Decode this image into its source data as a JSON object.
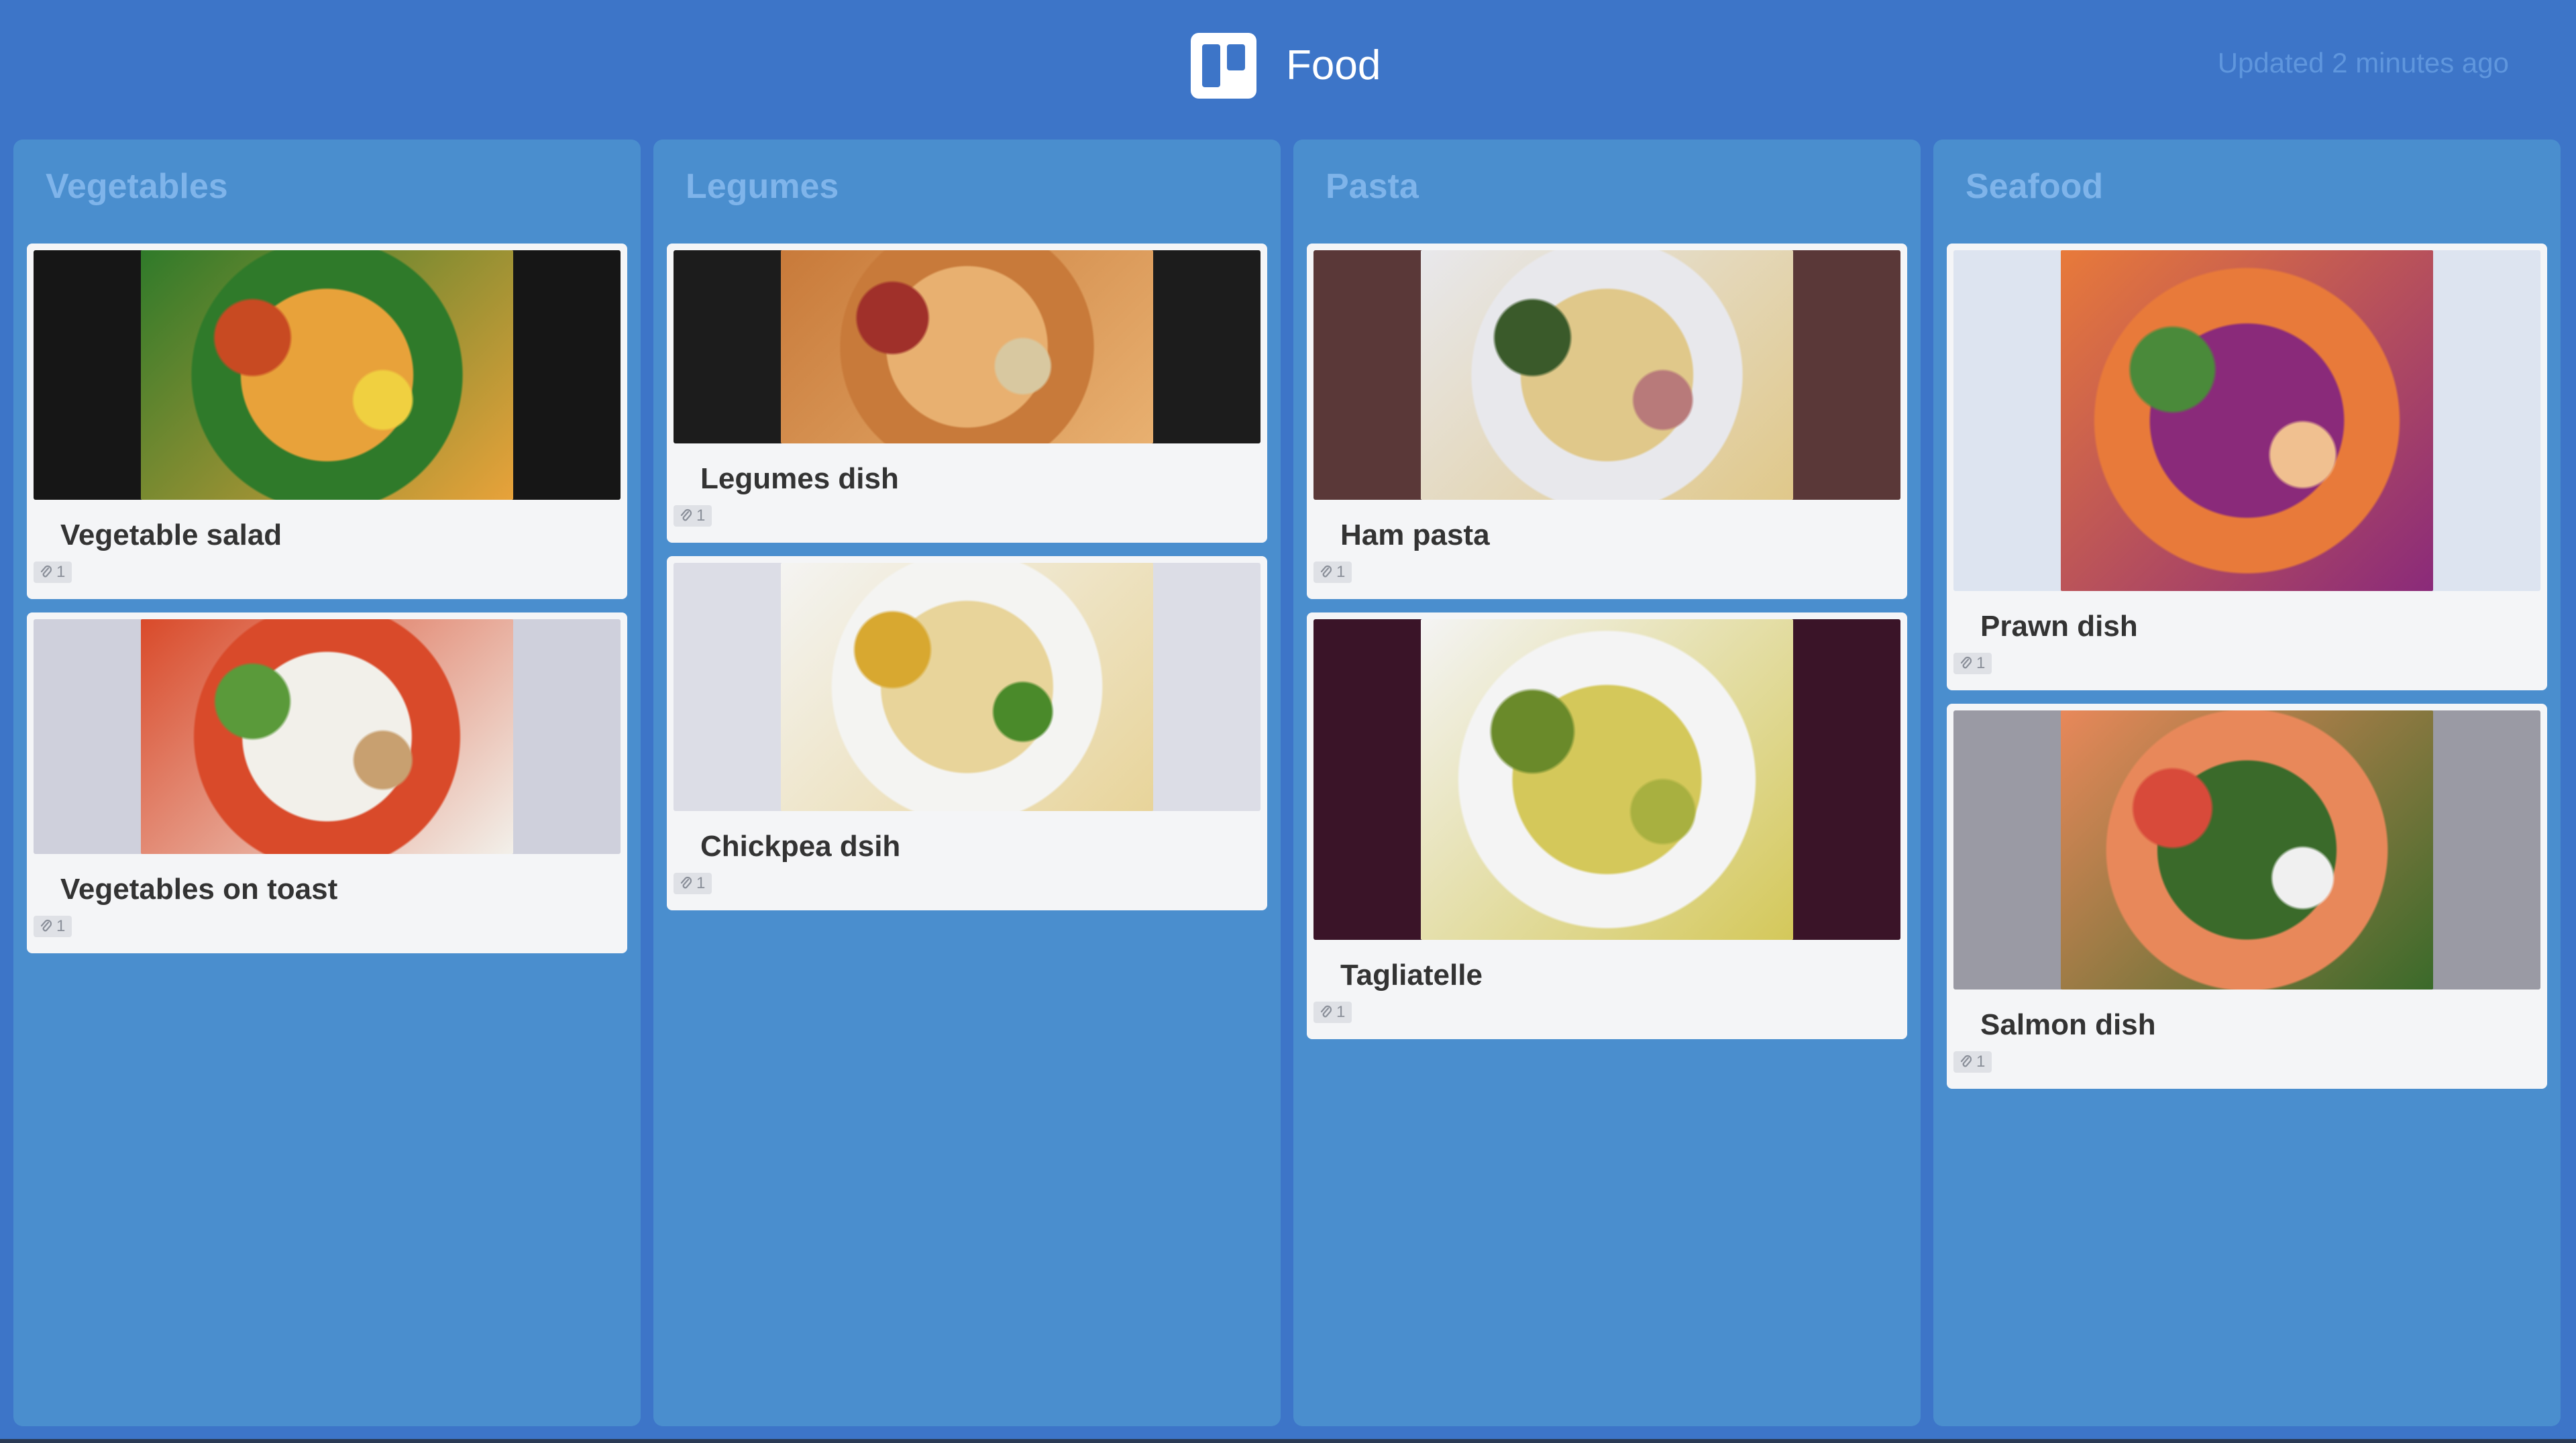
{
  "header": {
    "board_title": "Food",
    "updated_text": "Updated 2 minutes ago",
    "logo_icon": "trello-board-icon"
  },
  "colors": {
    "background": "#3d75c8",
    "column": "#4a8ece",
    "column_title": "#7fb4ea",
    "card": "#f4f5f7",
    "updated_text": "#5f96dd"
  },
  "columns": [
    {
      "title": "Vegetables",
      "cards": [
        {
          "title": "Vegetable salad",
          "attachments": "1",
          "cover_bg": "#161616",
          "photo_colors": [
            "#2f7a2a",
            "#e8a23a",
            "#c84a22",
            "#f0d040"
          ]
        },
        {
          "title": "Vegetables on toast",
          "attachments": "1",
          "cover_bg": "#cfd0dc",
          "photo_colors": [
            "#d94a2a",
            "#f2f0ea",
            "#5a9a3a",
            "#c8a070"
          ]
        }
      ]
    },
    {
      "title": "Legumes",
      "cards": [
        {
          "title": "Legumes dish",
          "attachments": "1",
          "cover_bg": "#1c1c1c",
          "photo_colors": [
            "#c87a3a",
            "#e8b070",
            "#a0302a",
            "#d8c8a0"
          ]
        },
        {
          "title": "Chickpea dsih",
          "attachments": "1",
          "cover_bg": "#dcdde6",
          "photo_colors": [
            "#f4f4f2",
            "#e8d49a",
            "#d8a830",
            "#4a8a2a"
          ]
        }
      ]
    },
    {
      "title": "Pasta",
      "cards": [
        {
          "title": "Ham pasta",
          "attachments": "1",
          "cover_bg": "#5a3838",
          "photo_colors": [
            "#e8e8ec",
            "#e0c88a",
            "#3a5a2a",
            "#b87a7a"
          ]
        },
        {
          "title": "Tagliatelle",
          "attachments": "1",
          "cover_bg": "#3a1428",
          "photo_colors": [
            "#f4f4f4",
            "#d4c85a",
            "#6a8a2a",
            "#a8b040"
          ]
        }
      ]
    },
    {
      "title": "Seafood",
      "cards": [
        {
          "title": "Prawn dish",
          "attachments": "1",
          "cover_bg": "#dde4f0",
          "photo_colors": [
            "#e87a3a",
            "#8a2a7a",
            "#4a8a3a",
            "#f0c090"
          ]
        },
        {
          "title": "Salmon dish",
          "attachments": "1",
          "cover_bg": "#9a9aa4",
          "photo_colors": [
            "#e8885a",
            "#3a6a2a",
            "#d84a3a",
            "#f0f0f0"
          ]
        }
      ]
    }
  ]
}
